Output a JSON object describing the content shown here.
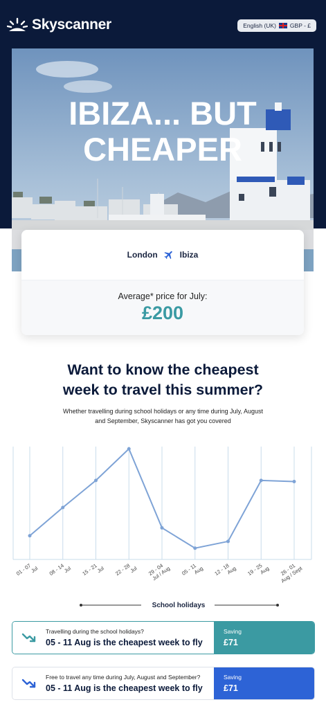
{
  "brand": {
    "name": "Skyscanner"
  },
  "locale": {
    "label": "English (UK)",
    "currency": "GBP - £"
  },
  "hero": {
    "title_line1": "IBIZA... BUT",
    "title_line2": "CHEAPER"
  },
  "route": {
    "from": "London",
    "to": "Ibiza"
  },
  "price": {
    "label": "Average* price for July:",
    "value": "£200"
  },
  "headline": {
    "line1": "Want to know the cheapest",
    "line2": "week to travel this summer?",
    "sub1": "Whether travelling during school holidays or any time during July, August",
    "sub2": "and September, Skyscanner has got you covered"
  },
  "chart_data": {
    "type": "line",
    "categories": [
      [
        "01 - 07",
        "Jul"
      ],
      [
        "08 - 14",
        "Jul"
      ],
      [
        "15 - 21",
        "Jul"
      ],
      [
        "22 - 28",
        "Jul"
      ],
      [
        "29 - 04",
        "Jul / Aug"
      ],
      [
        "05 - 11",
        "Aug"
      ],
      [
        "12 - 18",
        "Aug"
      ],
      [
        "19 - 25",
        "Aug"
      ],
      [
        "26 - 01",
        "Aug / Sept"
      ]
    ],
    "values": [
      0.21,
      0.46,
      0.7,
      0.98,
      0.28,
      0.1,
      0.16,
      0.7,
      0.69
    ],
    "ylim": [
      0,
      1
    ],
    "grid": true,
    "annotation": "School holidays",
    "line_color": "#7ea3d6"
  },
  "cards": [
    {
      "subtitle": "Travelling during the school holidays?",
      "title": "05 - 11 Aug is the cheapest week to fly",
      "saving_label": "Saving",
      "saving_value": "£71",
      "color": "#3b9aa2"
    },
    {
      "subtitle": "Free to travel any time during July, August and September?",
      "title": "05 - 11 Aug is the cheapest week to fly",
      "saving_label": "Saving",
      "saving_value": "£71",
      "color": "#2d63d6"
    }
  ]
}
